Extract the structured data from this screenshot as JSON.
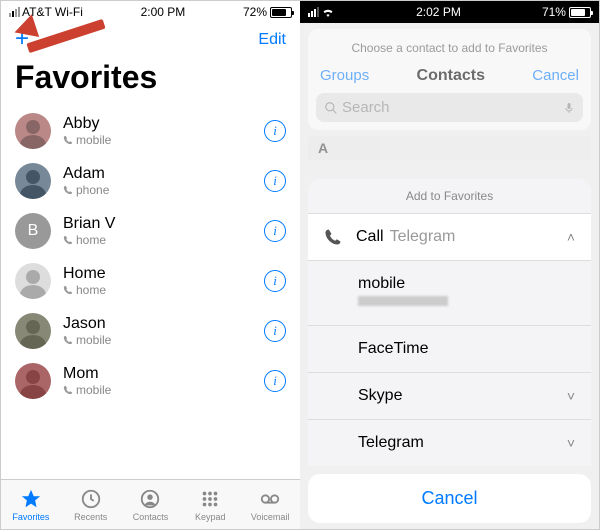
{
  "left": {
    "status": {
      "carrier": "AT&T Wi-Fi",
      "time": "2:00 PM",
      "battery": "72%"
    },
    "nav": {
      "add": "+",
      "edit": "Edit"
    },
    "title": "Favorites",
    "contacts": [
      {
        "name": "Abby",
        "sub": "mobile",
        "avatar": "photo1"
      },
      {
        "name": "Adam",
        "sub": "phone",
        "avatar": "photo2"
      },
      {
        "name": "Brian V",
        "sub": "home",
        "avatar": "letter",
        "letter": "B"
      },
      {
        "name": "Home",
        "sub": "home",
        "avatar": "photo3"
      },
      {
        "name": "Jason",
        "sub": "mobile",
        "avatar": "photo4"
      },
      {
        "name": "Mom",
        "sub": "mobile",
        "avatar": "photo5"
      }
    ],
    "tabs": [
      {
        "label": "Favorites",
        "icon": "star",
        "active": true
      },
      {
        "label": "Recents",
        "icon": "clock",
        "active": false
      },
      {
        "label": "Contacts",
        "icon": "person",
        "active": false
      },
      {
        "label": "Keypad",
        "icon": "grid",
        "active": false
      },
      {
        "label": "Voicemail",
        "icon": "voicemail",
        "active": false
      }
    ]
  },
  "right": {
    "status": {
      "time": "2:02 PM",
      "battery": "71%"
    },
    "picker": {
      "header": "Choose a contact to add to Favorites",
      "groups": "Groups",
      "title": "Contacts",
      "cancel": "Cancel",
      "search_placeholder": "Search",
      "section": "A"
    },
    "sheet": {
      "title": "Add to Favorites",
      "call_label": "Call",
      "call_secondary": "Telegram",
      "rows": [
        {
          "label": "mobile",
          "redacted": true
        },
        {
          "label": "FaceTime"
        },
        {
          "label": "Skype",
          "chev": true
        },
        {
          "label": "Telegram",
          "chev": true
        }
      ],
      "cancel": "Cancel"
    }
  }
}
